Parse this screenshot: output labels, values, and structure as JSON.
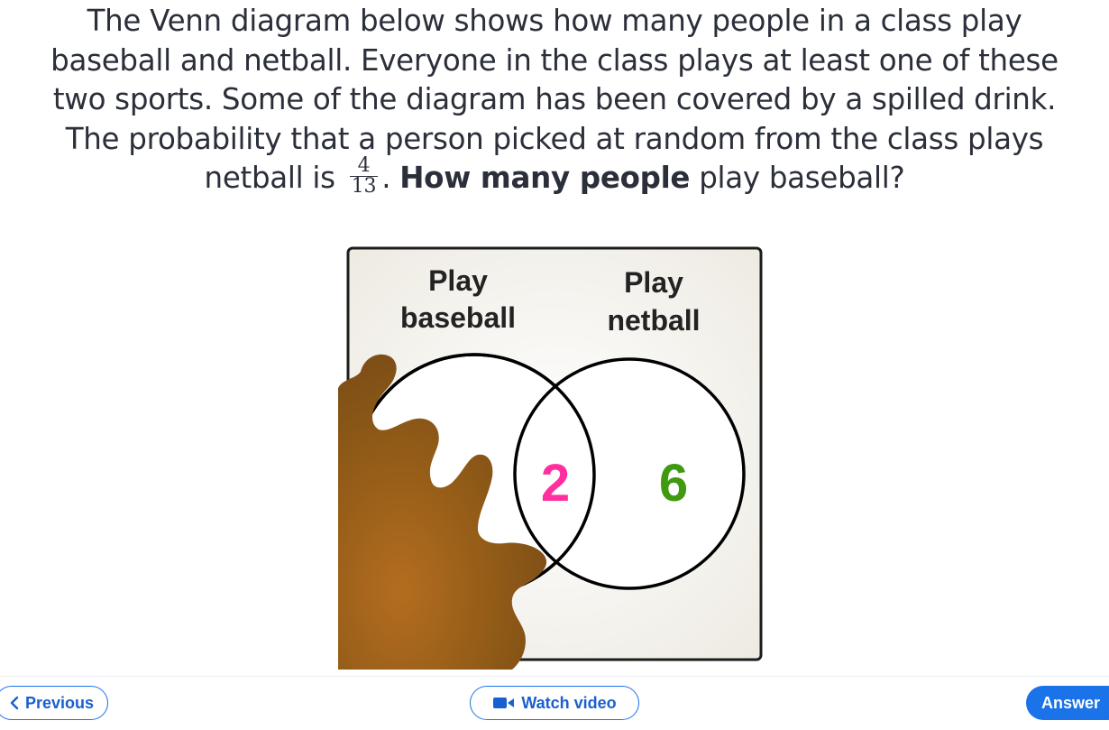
{
  "question": {
    "line1": "The Venn diagram below shows how many people in a class play",
    "line2": "baseball and netball. Everyone in the class plays at least one of these",
    "line3": "two sports. Some of the diagram has been covered by a spilled drink.",
    "line4": "The probability that a person picked at random from the class plays",
    "line5_before": "netball is",
    "fraction_numerator": "4",
    "fraction_denominator": "13",
    "line5_after_fraction": ".",
    "line5_bold": "How many people",
    "line5_end": "play baseball?"
  },
  "venn": {
    "set_a_label_line1": "Play",
    "set_a_label_line2": "baseball",
    "set_b_label_line1": "Play",
    "set_b_label_line2": "netball",
    "intersection_value": "2",
    "b_only_value": "6",
    "colors": {
      "intersection": "#ff2fa0",
      "b_only": "#3f9a10",
      "spill": "#8f5a17",
      "box_fill": "#f1efe8"
    }
  },
  "nav": {
    "previous_label": "Previous",
    "watch_video_label": "Watch video",
    "answer_label": "Answer"
  }
}
